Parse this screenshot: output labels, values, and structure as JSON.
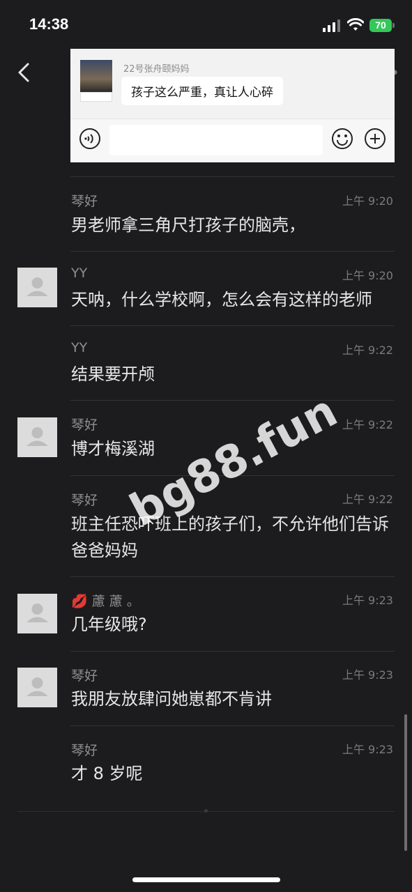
{
  "status_bar": {
    "time": "14:38",
    "battery": "70"
  },
  "embed": {
    "sender_name": "22号张舟颐妈妈",
    "message": "孩子这么严重，真让人心碎"
  },
  "messages": [
    {
      "sender": "琴好",
      "time": "上午 9:20",
      "text": "男老师拿三角尺打孩子的脑壳，",
      "avatar": false
    },
    {
      "sender": "YY",
      "time": "上午 9:20",
      "text": "天呐，什么学校啊，怎么会有这样的老师",
      "avatar": true
    },
    {
      "sender": "YY",
      "time": "上午 9:22",
      "text": "结果要开颅",
      "avatar": false
    },
    {
      "sender": "琴好",
      "time": "上午 9:22",
      "text": "博才梅溪湖",
      "avatar": true
    },
    {
      "sender": "琴好",
      "time": "上午 9:22",
      "text": "班主任恐吓班上的孩子们，不允许他们告诉爸爸妈妈",
      "avatar": false
    },
    {
      "sender": "💋 藘 藘 。",
      "time": "上午 9:23",
      "text": "几年级哦?",
      "avatar": true
    },
    {
      "sender": "琴好",
      "time": "上午 9:23",
      "text": "我朋友放肆问她崽都不肯讲",
      "avatar": true
    },
    {
      "sender": "琴好",
      "time": "上午 9:23",
      "text": "才 8 岁呢",
      "avatar": false
    }
  ],
  "watermark": "bg88.fun",
  "colors": {
    "background": "#1c1c1e",
    "battery": "#34c759"
  }
}
